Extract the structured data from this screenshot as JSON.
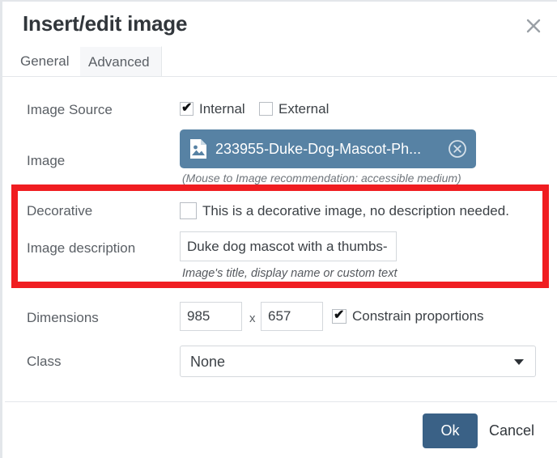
{
  "dialog": {
    "title": "Insert/edit image",
    "close_icon": "close-icon"
  },
  "tabs": [
    {
      "label": "General",
      "active": true
    },
    {
      "label": "Advanced",
      "active": false
    }
  ],
  "form": {
    "image_source": {
      "label": "Image Source",
      "options": [
        {
          "label": "Internal",
          "checked": true
        },
        {
          "label": "External",
          "checked": false
        }
      ]
    },
    "image": {
      "label": "Image",
      "chip_filename": "233955-Duke-Dog-Mascot-Ph...",
      "chip_icon": "image-file-icon",
      "remove_icon": "remove-circle-icon",
      "helper": "(Mouse to Image recommendation: accessible medium)"
    },
    "decorative": {
      "label": "Decorative",
      "checkbox_label": "This is a decorative image, no description needed.",
      "checked": false
    },
    "image_description": {
      "label": "Image description",
      "value": "Duke dog mascot with a thumbs-",
      "helper": "Image's title, display name or custom text"
    },
    "dimensions": {
      "label": "Dimensions",
      "width": "985",
      "separator": "x",
      "height": "657",
      "constrain_label": "Constrain proportions",
      "constrain_checked": true
    },
    "class_field": {
      "label": "Class",
      "value": "None",
      "arrow_icon": "chevron-down-icon"
    }
  },
  "footer": {
    "ok_label": "Ok",
    "cancel_label": "Cancel"
  },
  "annotation": {
    "color": "#f01d21",
    "name": "red-highlight-box"
  }
}
